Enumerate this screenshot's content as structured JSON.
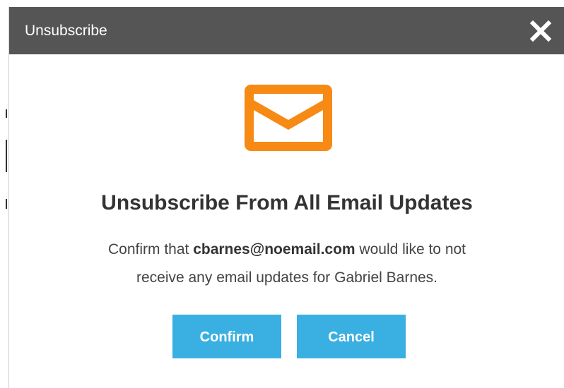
{
  "dialog": {
    "title": "Unsubscribe",
    "close_icon": "close-icon",
    "mail_icon": "envelope-icon",
    "accent_color": "#f78a14",
    "heading": "Unsubscribe From All Email Updates",
    "message": {
      "prefix": "Confirm that",
      "email": "cbarnes@noemail.com",
      "suffix_line1": "would like to not",
      "line2": "receive any email updates for Gabriel Barnes."
    },
    "buttons": {
      "confirm_label": "Confirm",
      "cancel_label": "Cancel",
      "color": "#3ab0e2"
    }
  }
}
